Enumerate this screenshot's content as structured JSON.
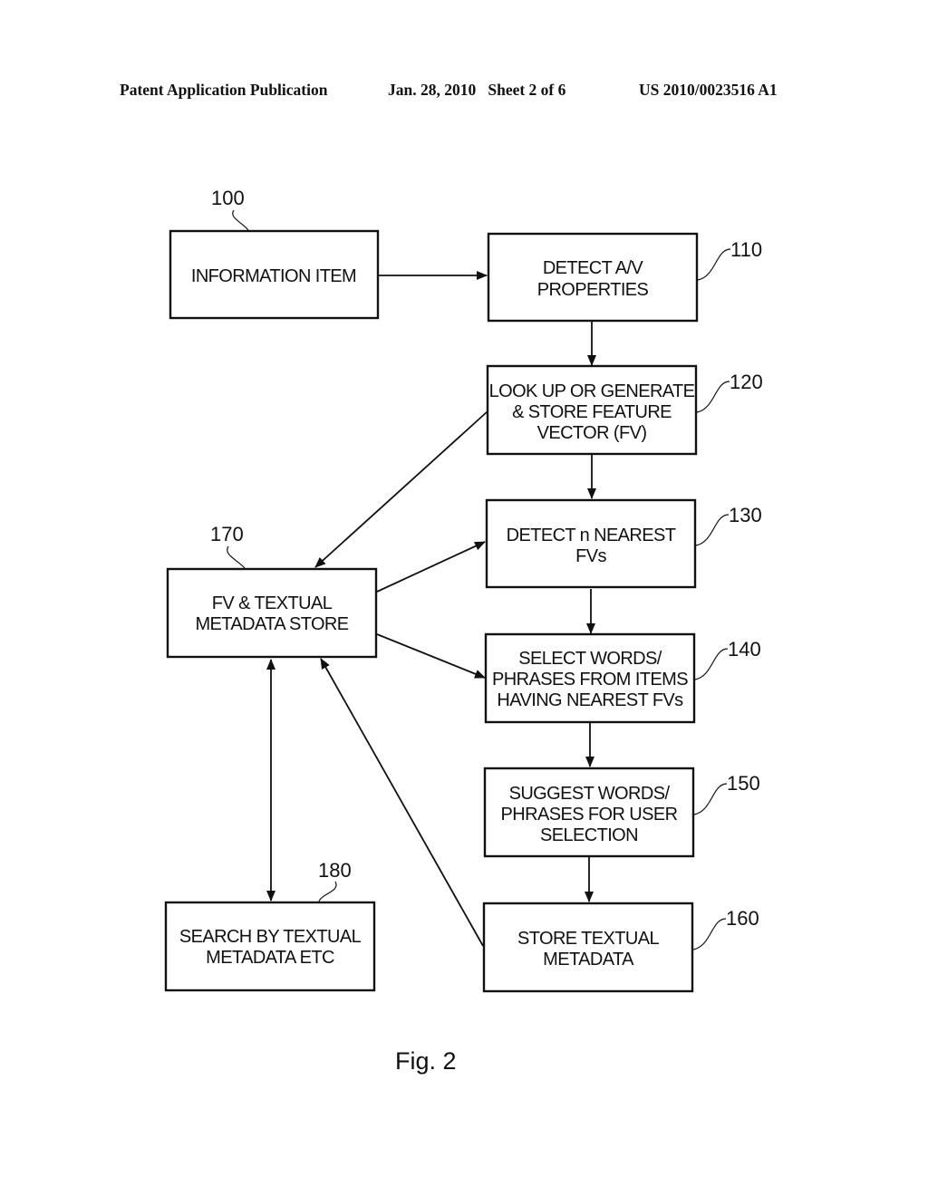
{
  "header": {
    "publication_type": "Patent Application Publication",
    "date_sheet": "Jan. 28, 2010   Sheet 2 of 6",
    "publication_number": "US 2010/0023516 A1"
  },
  "figure": {
    "caption": "Fig. 2",
    "nodes": [
      {
        "id": "100",
        "ref": "100",
        "lines": [
          "INFORMATION ITEM"
        ]
      },
      {
        "id": "110",
        "ref": "110",
        "lines": [
          "DETECT A/V",
          "PROPERTIES"
        ]
      },
      {
        "id": "120",
        "ref": "120",
        "lines": [
          "LOOK UP OR GENERATE",
          "& STORE FEATURE",
          "VECTOR (FV)"
        ]
      },
      {
        "id": "130",
        "ref": "130",
        "lines": [
          "DETECT n NEAREST",
          "FVs"
        ]
      },
      {
        "id": "140",
        "ref": "140",
        "lines": [
          "SELECT WORDS/",
          "PHRASES FROM ITEMS",
          "HAVING NEAREST FVs"
        ]
      },
      {
        "id": "150",
        "ref": "150",
        "lines": [
          "SUGGEST WORDS/",
          "PHRASES FOR USER",
          "SELECTION"
        ]
      },
      {
        "id": "160",
        "ref": "160",
        "lines": [
          "STORE TEXTUAL",
          "METADATA"
        ]
      },
      {
        "id": "170",
        "ref": "170",
        "lines": [
          "FV & TEXTUAL",
          "METADATA STORE"
        ]
      },
      {
        "id": "180",
        "ref": "180",
        "lines": [
          "SEARCH BY TEXTUAL",
          "METADATA ETC"
        ]
      }
    ],
    "edges": [
      {
        "from": "100",
        "to": "110",
        "direction": "forward"
      },
      {
        "from": "110",
        "to": "120",
        "direction": "forward"
      },
      {
        "from": "120",
        "to": "130",
        "direction": "forward"
      },
      {
        "from": "130",
        "to": "140",
        "direction": "forward"
      },
      {
        "from": "140",
        "to": "150",
        "direction": "forward"
      },
      {
        "from": "150",
        "to": "160",
        "direction": "forward"
      },
      {
        "from": "120",
        "to": "170",
        "direction": "forward"
      },
      {
        "from": "170",
        "to": "130",
        "direction": "forward"
      },
      {
        "from": "170",
        "to": "140",
        "direction": "forward"
      },
      {
        "from": "160",
        "to": "170",
        "direction": "forward"
      },
      {
        "from": "170",
        "to": "180",
        "direction": "bidirectional"
      }
    ]
  }
}
